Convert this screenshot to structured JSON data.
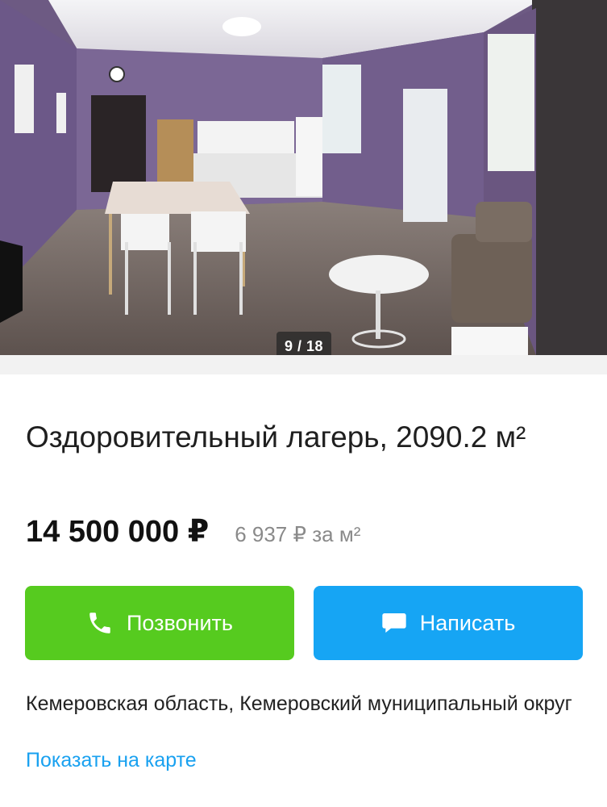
{
  "gallery": {
    "counter": "9 / 18",
    "image_description_icon": "photo-room-interior"
  },
  "listing": {
    "title": "Оздоровительный лагерь, 2090.2 м²",
    "price": "14 500 000 ₽",
    "price_per_m2": "6 937 ₽ за м²"
  },
  "actions": {
    "call_label": "Позвонить",
    "call_icon": "phone-icon",
    "write_label": "Написать",
    "write_icon": "chat-bubble-icon"
  },
  "location": {
    "address": "Кемеровская область, Кемеровский муниципальный округ",
    "map_link": "Показать на карте"
  },
  "colors": {
    "call_button": "#56cb1f",
    "write_button": "#16a5f4",
    "link": "#19a1f0"
  }
}
